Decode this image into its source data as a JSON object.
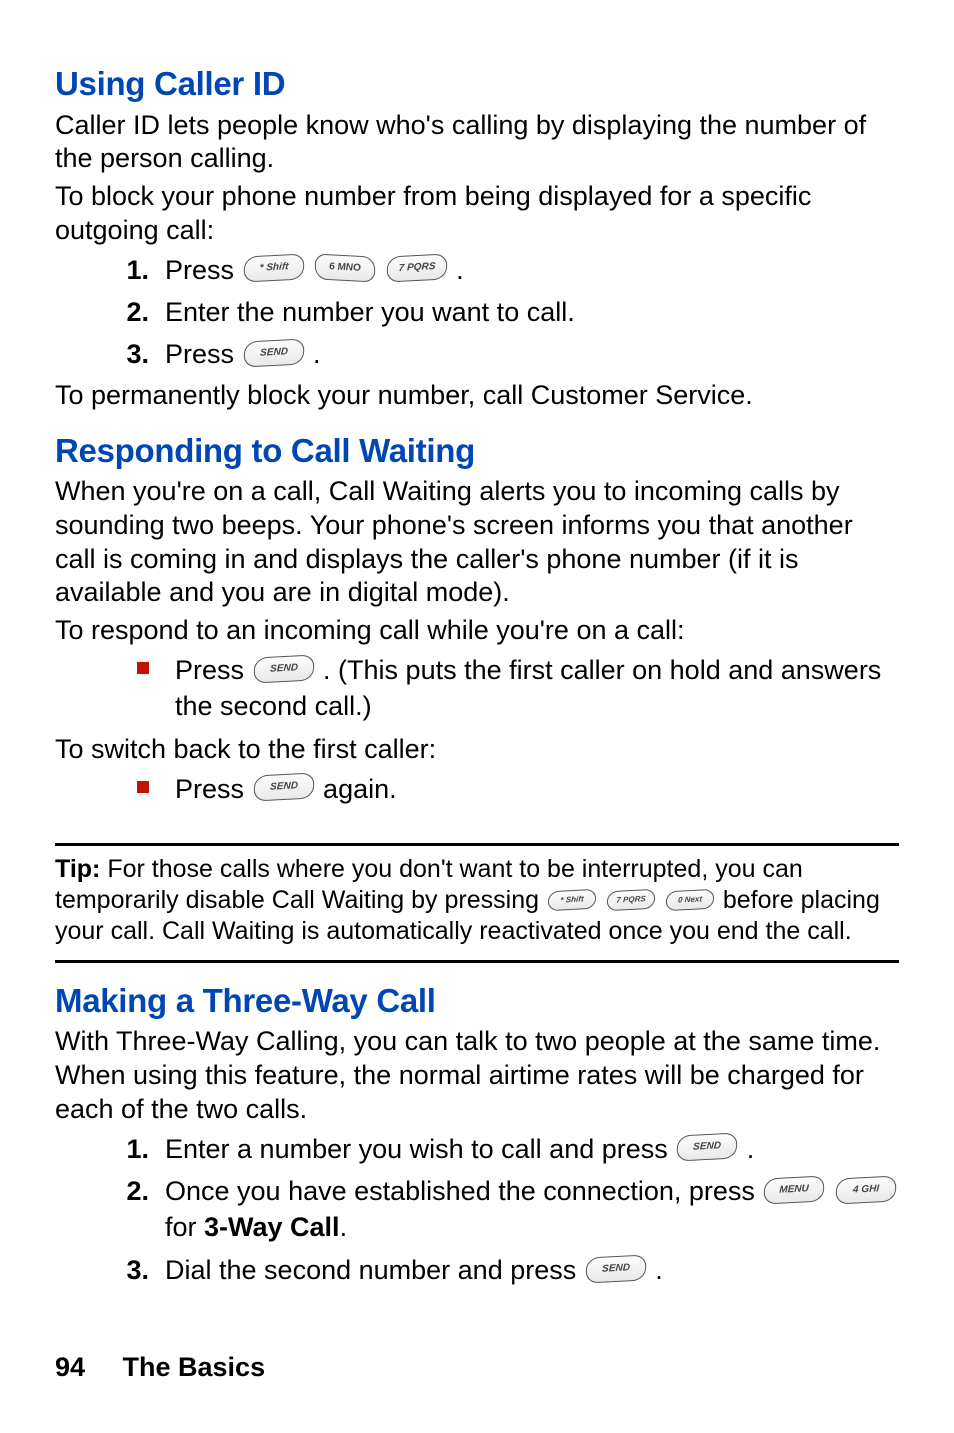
{
  "sections": {
    "callerId": {
      "title": "Using Caller ID",
      "intro1": "Caller ID lets people know who's calling by displaying the number of the person calling.",
      "intro2": "To block your phone number from being displayed for a specific outgoing call:",
      "steps": {
        "s1_pre": "Press ",
        "s1_k1": "* Shift",
        "s1_k2": "6 MNO",
        "s1_k3": "7 PQRS",
        "s1_post": ".",
        "s2": "Enter the number you want to call.",
        "s3_pre": "Press ",
        "s3_k1": "SEND",
        "s3_post": "."
      },
      "after": "To permanently block your number, call Customer Service."
    },
    "callWaiting": {
      "title": "Responding to Call Waiting",
      "p1": "When you're on a call, Call Waiting alerts you to incoming calls by sounding two beeps. Your phone's screen informs you that another call is coming in and displays the caller's phone number (if it is available and you are in digital mode).",
      "p2": "To respond to an incoming call while you're on a call:",
      "b1_pre": "Press ",
      "b1_key": "SEND",
      "b1_post": ". (This puts the first caller on hold and answers the second call.)",
      "p3": "To switch back to the first caller:",
      "b2_pre": "Press ",
      "b2_key": "SEND",
      "b2_post": " again."
    },
    "tip": {
      "label": "Tip:",
      "text_pre": " For those calls where you don't want to be interrupted, you can temporarily disable Call Waiting by pressing ",
      "k1": "* Shift",
      "k2": "7 PQRS",
      "k3": "0 Next",
      "text_post": " before placing your call. Call Waiting is automatically reactivated once you end the call."
    },
    "threeWay": {
      "title": "Making a Three-Way Call",
      "p1": "With Three-Way Calling, you can talk to two people at the same time. When using this feature, the normal airtime rates will be charged for each of the two calls.",
      "s1_pre": "Enter a number you wish to call and press ",
      "s1_key": "SEND",
      "s1_post": ".",
      "s2_pre": "Once you have established the connection, press ",
      "s2_k1": "MENU",
      "s2_k2": "4 GHI",
      "s2_mid": " for ",
      "s2_bold": "3-Way Call",
      "s2_post": ".",
      "s3_pre": "Dial the second number and press ",
      "s3_key": "SEND",
      "s3_post": "."
    }
  },
  "nums": {
    "n1": "1.",
    "n2": "2.",
    "n3": "3."
  },
  "footer": {
    "page": "94",
    "title": "The Basics"
  }
}
